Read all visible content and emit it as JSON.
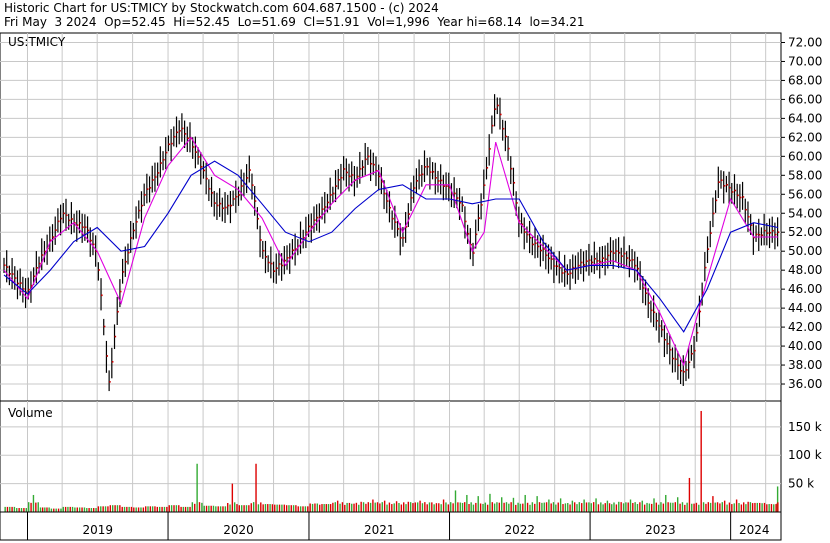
{
  "header": {
    "line1": "Historic Chart for US:TMICY by Stockwatch.com 604.687.1500 - (c) 2024",
    "line2": "Fri May  3 2024  Op=52.45  Hi=52.45  Lo=51.69  Cl=51.91  Vol=1,996  Year hi=68.14  lo=34.21"
  },
  "colors": {
    "price_bar": "#000000",
    "price_dot": "#cc0000",
    "ma_short": "#e000e0",
    "ma_long": "#0000cc",
    "vol_up": "#33aa33",
    "vol_down": "#dd0000",
    "grid": "#c8c8c8"
  },
  "chart_data": [
    {
      "type": "line",
      "title": "US:TMICY",
      "y_ticks": [
        "72.00",
        "70.00",
        "68.00",
        "66.00",
        "64.00",
        "62.00",
        "60.00",
        "58.00",
        "56.00",
        "54.00",
        "52.00",
        "50.00",
        "48.00",
        "46.00",
        "44.00",
        "42.00",
        "40.00",
        "38.00",
        "36.00"
      ],
      "ylim": [
        34.21,
        73.0
      ],
      "x_year_labels": [
        "2019",
        "2020",
        "2021",
        "2022",
        "2023",
        "2024"
      ],
      "series": [
        {
          "style": "price",
          "x": [
            "2018-11",
            "2018-12",
            "2019-01",
            "2019-02",
            "2019-03",
            "2019-04",
            "2019-05",
            "2019-06",
            "2019-07",
            "2019-08",
            "2019-09",
            "2019-10",
            "2019-11",
            "2019-12",
            "2020-01",
            "2020-02",
            "2020-03",
            "2020-04",
            "2020-05",
            "2020-06",
            "2020-07",
            "2020-08",
            "2020-09",
            "2020-10",
            "2020-11",
            "2020-12",
            "2021-01",
            "2021-02",
            "2021-03",
            "2021-04",
            "2021-05",
            "2021-06",
            "2021-07",
            "2021-08",
            "2021-09",
            "2021-10",
            "2021-11",
            "2021-12",
            "2022-01",
            "2022-02",
            "2022-03",
            "2022-04",
            "2022-05",
            "2022-06",
            "2022-07",
            "2022-08",
            "2022-09",
            "2022-10",
            "2022-11",
            "2022-12",
            "2023-01",
            "2023-02",
            "2023-03",
            "2023-04",
            "2023-05",
            "2023-06",
            "2023-07",
            "2023-08",
            "2023-09",
            "2023-10",
            "2023-11",
            "2023-12",
            "2024-01",
            "2024-02",
            "2024-03",
            "2024-04",
            "2024-05"
          ],
          "values": [
            48.5,
            47.0,
            45.5,
            49.0,
            51.0,
            54.0,
            53.0,
            52.5,
            49.5,
            36.0,
            47.0,
            52.0,
            56.0,
            58.0,
            61.0,
            63.0,
            61.5,
            58.5,
            55.0,
            54.5,
            56.0,
            58.5,
            50.0,
            48.0,
            49.0,
            50.5,
            52.5,
            54.0,
            56.0,
            58.5,
            57.5,
            60.0,
            58.0,
            54.0,
            51.0,
            57.0,
            59.0,
            57.5,
            56.5,
            55.0,
            49.5,
            57.0,
            66.0,
            61.0,
            53.0,
            51.0,
            50.0,
            48.5,
            47.5,
            48.5,
            49.0,
            49.0,
            50.0,
            49.5,
            48.5,
            44.5,
            42.0,
            39.0,
            37.0,
            40.0,
            50.0,
            57.5,
            56.5,
            55.5,
            51.5,
            52.0,
            51.91
          ]
        },
        {
          "name": "",
          "style": "ma_short",
          "x": [
            "2018-11",
            "2019-01",
            "2019-03",
            "2019-05",
            "2019-07",
            "2019-09",
            "2019-11",
            "2020-01",
            "2020-03",
            "2020-05",
            "2020-07",
            "2020-09",
            "2020-11",
            "2021-01",
            "2021-03",
            "2021-05",
            "2021-07",
            "2021-09",
            "2021-11",
            "2022-01",
            "2022-03",
            "2022-04",
            "2022-05",
            "2022-07",
            "2022-09",
            "2022-11",
            "2023-01",
            "2023-03",
            "2023-05",
            "2023-07",
            "2023-09",
            "2023-11",
            "2024-01",
            "2024-03",
            "2024-05"
          ],
          "values": [
            48.0,
            45.0,
            51.0,
            53.0,
            50.0,
            44.5,
            53.5,
            59.0,
            62.0,
            58.0,
            56.5,
            53.5,
            48.5,
            52.0,
            55.0,
            57.5,
            58.5,
            52.0,
            57.0,
            57.0,
            50.0,
            52.0,
            61.5,
            53.0,
            50.5,
            48.0,
            48.5,
            49.0,
            48.0,
            43.5,
            38.0,
            47.0,
            55.5,
            51.5,
            51.5
          ]
        },
        {
          "name": "",
          "style": "ma_long",
          "x": [
            "2018-11",
            "2019-01",
            "2019-03",
            "2019-05",
            "2019-07",
            "2019-09",
            "2019-11",
            "2020-01",
            "2020-03",
            "2020-05",
            "2020-07",
            "2020-09",
            "2020-11",
            "2021-01",
            "2021-03",
            "2021-05",
            "2021-07",
            "2021-09",
            "2021-11",
            "2022-01",
            "2022-03",
            "2022-05",
            "2022-07",
            "2022-09",
            "2022-11",
            "2023-01",
            "2023-03",
            "2023-05",
            "2023-07",
            "2023-09",
            "2023-11",
            "2024-01",
            "2024-03",
            "2024-05"
          ],
          "values": [
            47.5,
            45.5,
            48.0,
            51.0,
            52.5,
            50.0,
            50.5,
            54.0,
            58.0,
            59.5,
            58.0,
            55.0,
            52.0,
            51.0,
            52.0,
            54.5,
            56.5,
            57.0,
            55.5,
            55.5,
            55.0,
            55.5,
            55.5,
            51.0,
            48.0,
            48.5,
            48.5,
            48.0,
            45.0,
            41.5,
            46.0,
            52.0,
            53.0,
            52.5
          ]
        }
      ]
    },
    {
      "type": "bar",
      "title": "Volume",
      "y_ticks": [
        "150 k",
        "100 k",
        "50 k"
      ],
      "ylim": [
        0,
        185000
      ],
      "categories": [
        "2018-11",
        "2018-12",
        "2019-01",
        "2019-02",
        "2019-03",
        "2019-04",
        "2019-05",
        "2019-06",
        "2019-07",
        "2019-08",
        "2019-09",
        "2019-10",
        "2019-11",
        "2019-12",
        "2020-01",
        "2020-02",
        "2020-03",
        "2020-04",
        "2020-05",
        "2020-06",
        "2020-07",
        "2020-08",
        "2020-09",
        "2020-10",
        "2020-11",
        "2020-12",
        "2021-01",
        "2021-02",
        "2021-03",
        "2021-04",
        "2021-05",
        "2021-06",
        "2021-07",
        "2021-08",
        "2021-09",
        "2021-10",
        "2021-11",
        "2021-12",
        "2022-01",
        "2022-02",
        "2022-03",
        "2022-04",
        "2022-05",
        "2022-06",
        "2022-07",
        "2022-08",
        "2022-09",
        "2022-10",
        "2022-11",
        "2022-12",
        "2023-01",
        "2023-02",
        "2023-03",
        "2023-04",
        "2023-05",
        "2023-06",
        "2023-07",
        "2023-08",
        "2023-09",
        "2023-10",
        "2023-11",
        "2023-12",
        "2024-01",
        "2024-02",
        "2024-03",
        "2024-04",
        "2024-05"
      ],
      "values": [
        9000,
        7000,
        30000,
        8000,
        6000,
        9000,
        8000,
        7000,
        10000,
        12000,
        9000,
        8000,
        10000,
        9000,
        12000,
        9000,
        85000,
        11000,
        10000,
        50000,
        12000,
        85000,
        14000,
        13000,
        12000,
        10000,
        15000,
        14000,
        20000,
        16000,
        18000,
        22000,
        20000,
        19000,
        18000,
        20000,
        17000,
        22000,
        38000,
        30000,
        28000,
        32000,
        26000,
        25000,
        30000,
        28000,
        22000,
        24000,
        20000,
        22000,
        24000,
        20000,
        18000,
        22000,
        20000,
        24000,
        30000,
        26000,
        60000,
        178000,
        28000,
        20000,
        22000,
        18000,
        16000,
        14000,
        45000
      ],
      "up_flags": [
        true,
        false,
        true,
        false,
        true,
        false,
        true,
        false,
        false,
        true,
        false,
        true,
        false,
        true,
        false,
        true,
        true,
        false,
        true,
        true,
        false,
        true,
        false,
        true,
        false,
        true,
        false,
        true,
        false,
        true,
        false,
        true,
        false,
        true,
        false,
        true,
        false,
        true,
        true,
        false,
        true,
        false,
        true,
        false,
        true,
        false,
        true,
        false,
        true,
        false,
        true,
        false,
        true,
        false,
        true,
        false,
        true,
        false,
        false,
        true,
        false,
        true,
        false,
        true,
        false,
        true,
        false
      ]
    }
  ]
}
